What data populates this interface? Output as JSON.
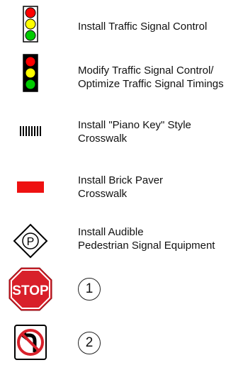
{
  "legend": {
    "items": [
      {
        "icon": "traffic-signal-outline-icon",
        "label_lines": [
          "Install Traffic Signal Control"
        ]
      },
      {
        "icon": "traffic-signal-filled-icon",
        "label_lines": [
          "Modify Traffic Signal Control/",
          "Optimize Traffic Signal Timings"
        ]
      },
      {
        "icon": "piano-key-crosswalk-icon",
        "label_lines": [
          "Install \"Piano Key\" Style",
          "Crosswalk"
        ]
      },
      {
        "icon": "brick-paver-crosswalk-icon",
        "label_lines": [
          "Install Brick Paver",
          "Crosswalk"
        ]
      },
      {
        "icon": "audible-pedestrian-signal-icon",
        "letter": "P",
        "label_lines": [
          "Install Audible",
          "Pedestrian Signal Equipment"
        ]
      },
      {
        "icon": "stop-sign-icon",
        "sign_text": "STOP",
        "number": "1"
      },
      {
        "icon": "no-left-turn-sign-icon",
        "number": "2"
      }
    ]
  },
  "colors": {
    "signal_red": "#ff0000",
    "signal_yellow": "#ffff00",
    "signal_green": "#00cc00",
    "brick_red": "#ee1111",
    "stop_red": "#d8202a"
  }
}
